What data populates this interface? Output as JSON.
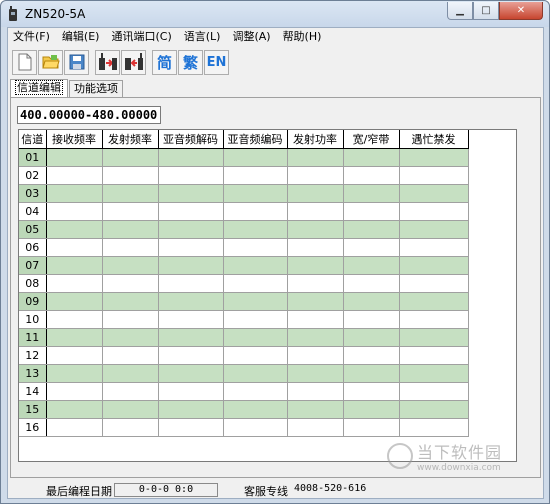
{
  "window": {
    "title": "ZN520-5A",
    "minimize_glyph": "▁",
    "maximize_glyph": "□",
    "close_glyph": "✕"
  },
  "menubar": {
    "items": [
      {
        "label": "文件(F)"
      },
      {
        "label": "编辑(E)"
      },
      {
        "label": "通讯端口(C)"
      },
      {
        "label": "语言(L)"
      },
      {
        "label": "调整(A)"
      },
      {
        "label": "帮助(H)"
      }
    ]
  },
  "toolbar": {
    "icons": [
      "new-file-icon",
      "open-folder-icon",
      "save-icon",
      "radio-read-icon",
      "radio-write-icon"
    ],
    "lang_simplified": "简",
    "lang_traditional": "繁",
    "lang_english": "EN"
  },
  "tabs": [
    {
      "label": "信道编辑",
      "active": true
    },
    {
      "label": "功能选项",
      "active": false
    }
  ],
  "freq_range": "400.00000-480.00000",
  "table": {
    "headers": [
      "信道",
      "接收频率",
      "发射频率",
      "亚音频解码",
      "亚音频编码",
      "发射功率",
      "宽/窄带",
      "遇忙禁发"
    ],
    "rows": [
      "01",
      "02",
      "03",
      "04",
      "05",
      "06",
      "07",
      "08",
      "09",
      "10",
      "11",
      "12",
      "13",
      "14",
      "15",
      "16"
    ]
  },
  "status": {
    "last_program_label": "最后编程日期",
    "last_program_value": "0-0-0   0:0",
    "service_label": "客服专线",
    "service_value": "4008-520-616"
  },
  "watermark": {
    "name": "当下软件园",
    "domain": "www.downxia.com"
  },
  "colors": {
    "row_shaded": "#c6e0c2",
    "lang_blue": "#1e73d6"
  }
}
